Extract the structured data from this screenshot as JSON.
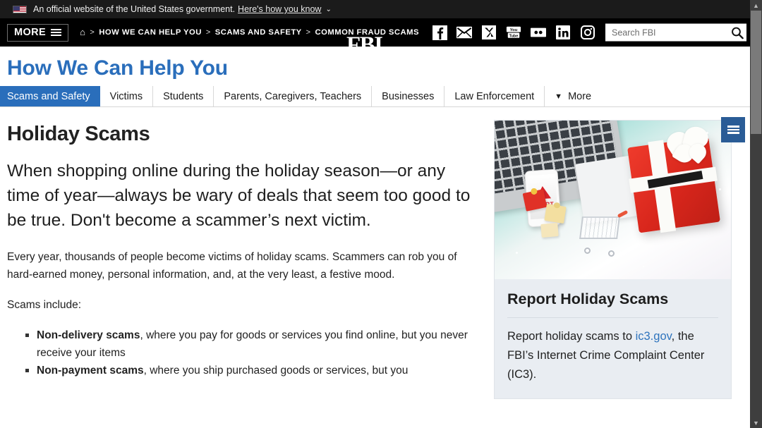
{
  "gov_banner": {
    "text": "An official website of the United States government.",
    "link": "Here's how you know",
    "caret": "⌄",
    "flag_icon": "us-flag-icon"
  },
  "navbar": {
    "more_label": "MORE",
    "home_icon": "⌂",
    "breadcrumb": [
      {
        "label": "HOW WE CAN HELP YOU"
      },
      {
        "label": "SCAMS AND SAFETY"
      },
      {
        "label": "COMMON FRAUD SCAMS"
      }
    ],
    "separator": ">",
    "logo": "FBI",
    "social": [
      {
        "name": "facebook-icon",
        "glyph": "f"
      },
      {
        "name": "email-icon",
        "glyph": "✉"
      },
      {
        "name": "x-twitter-icon",
        "glyph": "𝕏"
      },
      {
        "name": "youtube-icon",
        "glyph": "You Tube"
      },
      {
        "name": "flickr-icon",
        "glyph": "••"
      },
      {
        "name": "linkedin-icon",
        "glyph": "in"
      },
      {
        "name": "instagram-icon",
        "glyph": "◎"
      }
    ],
    "search": {
      "placeholder": "Search FBI",
      "value": "",
      "icon": "search-icon"
    }
  },
  "section": {
    "title": "How We Can Help You",
    "title_color": "#2a6ebb",
    "tabs": [
      {
        "label": "Scams and Safety",
        "active": true
      },
      {
        "label": "Victims",
        "active": false
      },
      {
        "label": "Students",
        "active": false
      },
      {
        "label": "Parents, Caregivers, Teachers",
        "active": false
      },
      {
        "label": "Businesses",
        "active": false
      },
      {
        "label": "Law Enforcement",
        "active": false
      }
    ],
    "more_tab": {
      "label": "More",
      "caret": "▼"
    }
  },
  "article": {
    "heading": "Holiday Scams",
    "lede": "When shopping online during the holiday season—or any time of year—always be wary of deals that seem too good to be true. Don't become a scammer’s next victim.",
    "paragraph": "Every year, thousands of people become victims of holiday scams. Scammers can rob you of hard-earned money, personal information, and, at the very least, a festive mood.",
    "list_intro": "Scams include:",
    "list": [
      {
        "bold": "Non-delivery scams",
        "rest": ", where you pay for goods or services you find online, but you never receive your items"
      },
      {
        "bold": "Non-payment scams",
        "rest": ", where you ship purchased goods or services, but you"
      }
    ]
  },
  "sidebar": {
    "image_alt": "holiday-scam-photo",
    "image_elements": {
      "phone_alert_text": "ALERT",
      "items": [
        "laptop-keyboard",
        "smartphone-alert",
        "shopping-cart",
        "gift-boxes",
        "red-gift-box",
        "credit-card"
      ]
    },
    "card_heading": "Report Holiday Scams",
    "card_text_before": "Report holiday scams to ",
    "card_link": "ic3.gov",
    "card_text_after": ", the FBI’s Internet Crime Complaint Center (IC3).",
    "link_color": "#2f74bd"
  },
  "side_tab": {
    "name": "page-menu-toggle",
    "color": "#2a5c96"
  },
  "scrollbar": {
    "up": "▲",
    "down": "▼"
  }
}
